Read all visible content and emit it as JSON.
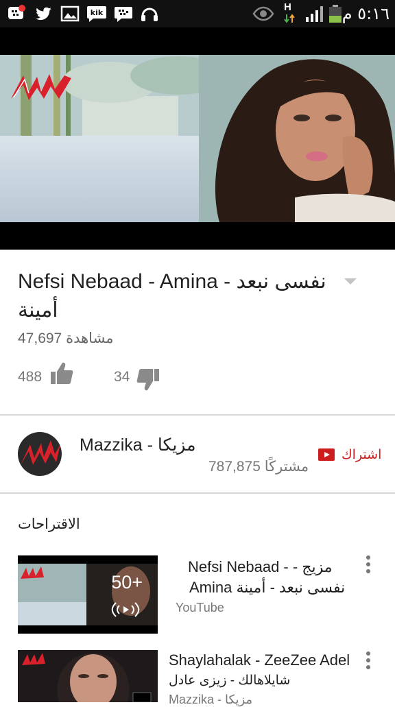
{
  "status_bar": {
    "time": "٥:١٦ م",
    "left_icons": [
      "bbm-notification-icon",
      "twitter-icon",
      "gallery-icon",
      "kik-icon",
      "bbm-icon",
      "headphones-icon"
    ],
    "right_icons": [
      "eye-icon",
      "network-h-icon",
      "signal-icon",
      "battery-icon"
    ],
    "network_label": "H"
  },
  "video": {
    "logo_label": "Mazzika"
  },
  "details": {
    "title": "Nefsi Nebaad - Amina - نفسى نبعد أمينة",
    "views_count": "47,697",
    "views_label": "مشاهدة",
    "likes": "488",
    "dislikes": "34"
  },
  "channel": {
    "name": "Mazzika - مزيكا",
    "subscribers_count": "787,875",
    "subscribers_label": "مشتركًا",
    "subscribe_label": "اشتراك"
  },
  "suggestions": {
    "header": "الاقتراحات",
    "items": [
      {
        "title_line1": "Nefsi Nebaad - - مزيج",
        "title_line2": "Amina نفسى نبعد - أمينة",
        "meta": "YouTube",
        "badge": "50+"
      },
      {
        "title_line1": "Shaylahalak - ZeeZee Adel",
        "title_line2": "شايلاهالك - زيزى عادل",
        "meta": "Mazzika - مزيكا"
      }
    ]
  },
  "colors": {
    "accent_red": "#cc1e1e",
    "status_bar": "#111111",
    "text_primary": "#222222",
    "text_secondary": "#777777"
  }
}
